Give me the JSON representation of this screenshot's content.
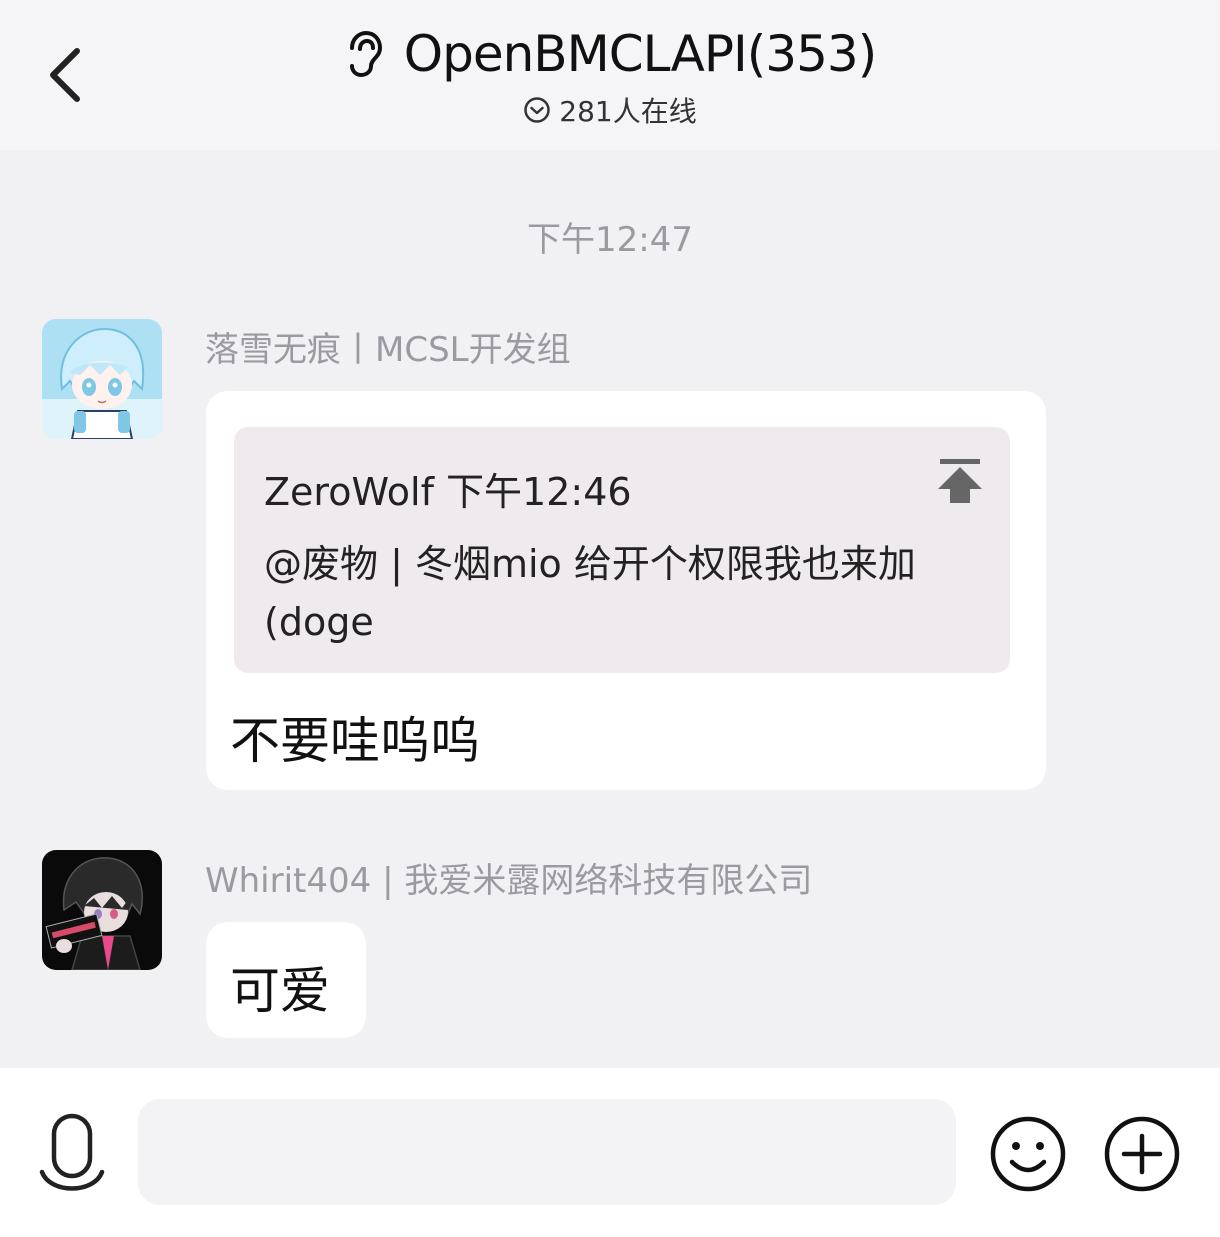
{
  "header": {
    "title": "OpenBMCLAPI(353)",
    "online_text": "281人在线"
  },
  "chat": {
    "timestamp": "下午12:47",
    "messages": [
      {
        "sender": "落雪无痕丨MCSL开发组",
        "quote": {
          "author_time": "ZeroWolf 下午12:46",
          "text": "@废物 | 冬烟mio 给开个权限我也来加 (doge"
        },
        "text": "不要哇呜呜"
      },
      {
        "sender": "Whirit404 | 我爱米露网络科技有限公司",
        "text": "可爱"
      }
    ]
  },
  "input": {
    "placeholder": ""
  },
  "colors": {
    "header_bg": "#f5f5f7",
    "chat_bg": "#f1f1f4",
    "bubble_bg": "#ffffff",
    "quote_bg": "#eeeaed",
    "meta_text": "#9a9aa0"
  },
  "icons": [
    "back-arrow-icon",
    "ear-icon",
    "online-check-icon",
    "scroll-to-quote-icon",
    "microphone-icon",
    "emoji-icon",
    "plus-icon"
  ]
}
